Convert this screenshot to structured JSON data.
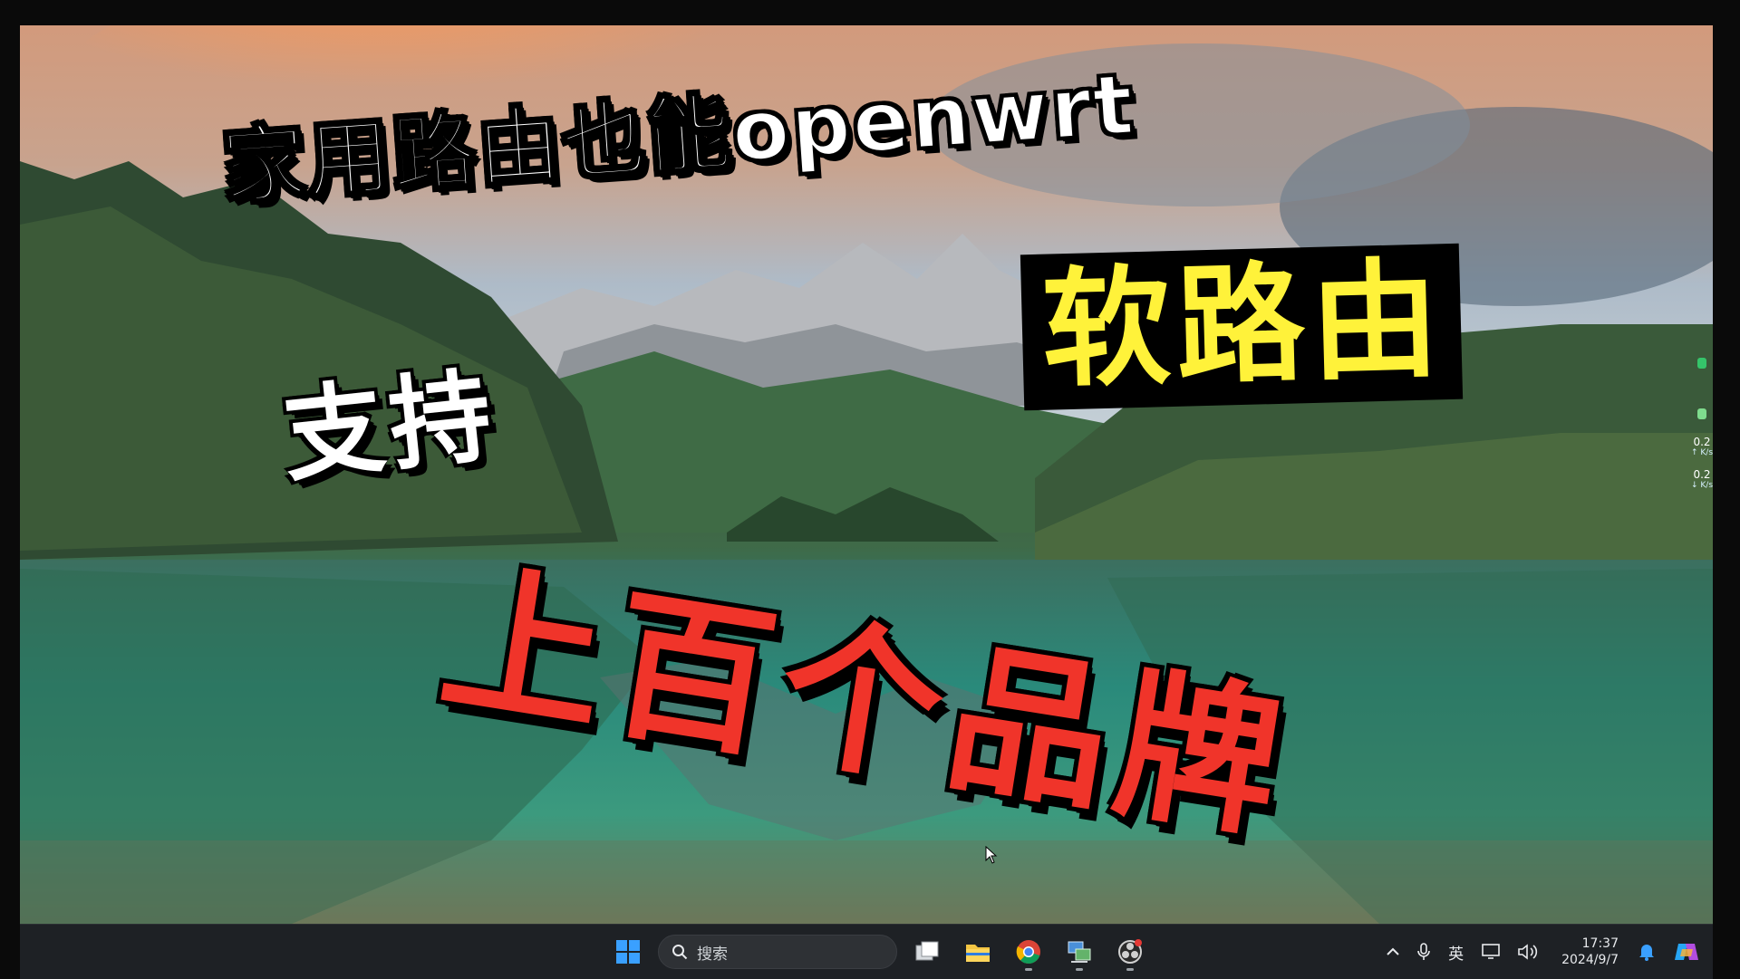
{
  "overlay": {
    "line1": "家用路由也能openwrt",
    "line2": "软路由",
    "line3": "支持",
    "line4": "上百个品牌"
  },
  "net_widget": {
    "upload_value": "0.2",
    "upload_unit": "↑ K/s",
    "download_value": "0.2",
    "download_unit": "↓ K/s"
  },
  "taskbar": {
    "start_icon": "windows-start-icon",
    "search_placeholder": "搜索",
    "apps": [
      {
        "name": "task-view-icon",
        "running": false
      },
      {
        "name": "file-explorer-icon",
        "running": false
      },
      {
        "name": "chrome-icon",
        "running": true
      },
      {
        "name": "network-app-icon",
        "running": true
      },
      {
        "name": "obs-icon",
        "running": true
      }
    ],
    "tray": {
      "chevron": "^",
      "ime_label": "英",
      "time": "17:37",
      "date": "2024/9/7"
    }
  },
  "colors": {
    "title_yellow": "#fff23a",
    "title_red": "#f0342a",
    "taskbar_bg": "#1e2125"
  }
}
